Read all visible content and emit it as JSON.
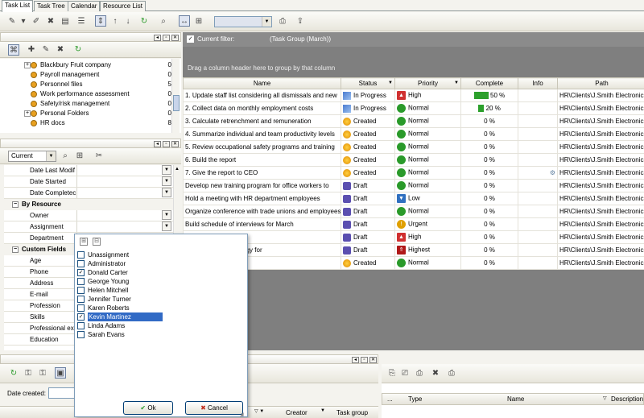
{
  "tabs": [
    "Task List",
    "Task Tree",
    "Calendar",
    "Resource List"
  ],
  "filter": {
    "label": "Current filter:",
    "value": "(Task Group  (March))"
  },
  "group_hint": "Drag a column header here to group by that column",
  "tree_items": [
    {
      "label": "Blackbury Fruit company",
      "count": "0",
      "expander": "+"
    },
    {
      "label": "Payroll management",
      "count": "0",
      "expander": ""
    },
    {
      "label": "Personnel files",
      "count": "5",
      "expander": ""
    },
    {
      "label": "Work performance assessment",
      "count": "0",
      "expander": ""
    },
    {
      "label": "Safety/risk management",
      "count": "0",
      "expander": ""
    },
    {
      "label": "Personal Folders",
      "count": "0",
      "expander": "+"
    },
    {
      "label": "HR docs",
      "count": "8",
      "expander": ""
    }
  ],
  "props_combo": "Current",
  "props": {
    "date_rows": [
      "Date Last Modif",
      "Date Started",
      "Date Completec"
    ],
    "cat_resource": "By Resource",
    "resource_rows": [
      "Owner",
      "Assignment",
      "Department"
    ],
    "cat_custom": "Custom Fields",
    "custom_rows": [
      "Age",
      "Phone",
      "Address",
      "E-mail",
      "Profession",
      "Skills",
      "Professional exp",
      "Education"
    ]
  },
  "columns": {
    "name": "Name",
    "status": "Status",
    "priority": "Priority",
    "complete": "Complete",
    "info": "Info",
    "path": "Path"
  },
  "rows": [
    {
      "name": "1. Update staff list considering all dismissals and new",
      "status": "In Progress",
      "priority": "High",
      "complete": "50 %",
      "path": "HR\\Clients\\J.Smith Electronics,"
    },
    {
      "name": "2. Collect data on monthly employment costs",
      "status": "In Progress",
      "priority": "Normal",
      "complete": "20 %",
      "path": "HR\\Clients\\J.Smith Electronics,"
    },
    {
      "name": "3. Calculate retrenchment and remuneration",
      "status": "Created",
      "priority": "Normal",
      "complete": "0 %",
      "path": "HR\\Clients\\J.Smith Electronics,"
    },
    {
      "name": "4. Summarize individual and team productivity levels",
      "status": "Created",
      "priority": "Normal",
      "complete": "0 %",
      "path": "HR\\Clients\\J.Smith Electronics,"
    },
    {
      "name": "5. Review occupational safety programs and training",
      "status": "Created",
      "priority": "Normal",
      "complete": "0 %",
      "path": "HR\\Clients\\J.Smith Electronics,"
    },
    {
      "name": "6. Build the report",
      "status": "Created",
      "priority": "Normal",
      "complete": "0 %",
      "path": "HR\\Clients\\J.Smith Electronics,"
    },
    {
      "name": "7. Give the report to CEO",
      "status": "Created",
      "priority": "Normal",
      "complete": "0 %",
      "path": "HR\\Clients\\J.Smith Electronics,"
    },
    {
      "name": "Develop new training program for office workers to",
      "status": "Draft",
      "priority": "Normal",
      "complete": "0 %",
      "path": "HR\\Clients\\J.Smith Electronics,"
    },
    {
      "name": "Hold a meeting with HR department employees",
      "status": "Draft",
      "priority": "Low",
      "complete": "0 %",
      "path": "HR\\Clients\\J.Smith Electronics,"
    },
    {
      "name": "Organize conference with trade unions and employees",
      "status": "Draft",
      "priority": "Normal",
      "complete": "0 %",
      "path": "HR\\Clients\\J.Smith Electronics,"
    },
    {
      "name": "Build schedule of interviews for March",
      "status": "Draft",
      "priority": "Urgent",
      "complete": "0 %",
      "path": "HR\\Clients\\J.Smith Electronics,"
    },
    {
      "name": "edit department",
      "status": "Draft",
      "priority": "High",
      "complete": "0 %",
      "path": "HR\\Clients\\J.Smith Electronics,"
    },
    {
      "name": "e management strategy for",
      "status": "Draft",
      "priority": "Highest",
      "complete": "0 %",
      "path": "HR\\Clients\\J.Smith Electronics,"
    },
    {
      "name": "training with staff",
      "status": "Created",
      "priority": "Normal",
      "complete": "0 %",
      "path": "HR\\Clients\\J.Smith Electronics,"
    }
  ],
  "popup": {
    "items": [
      {
        "label": "Unassignment",
        "checked": false,
        "selected": false
      },
      {
        "label": "Administrator",
        "checked": false,
        "selected": false
      },
      {
        "label": "Donald Carter",
        "checked": true,
        "selected": false
      },
      {
        "label": "George Young",
        "checked": false,
        "selected": false
      },
      {
        "label": "Helen Mitchell",
        "checked": false,
        "selected": false
      },
      {
        "label": "Jennifer Turner",
        "checked": false,
        "selected": false
      },
      {
        "label": "Karen Roberts",
        "checked": false,
        "selected": false
      },
      {
        "label": "Kevin Martinez",
        "checked": true,
        "selected": true
      },
      {
        "label": "Linda  Adams",
        "checked": false,
        "selected": false
      },
      {
        "label": "Sarah Evans",
        "checked": false,
        "selected": false
      }
    ],
    "ok": "Ok",
    "cancel": "Cancel"
  },
  "bottom": {
    "date_created": "Date created:",
    "creator": "Creator",
    "task_group": "Task group",
    "col_dots": "...",
    "col_type": "Type",
    "col_name": "Name",
    "col_desc": "Description"
  },
  "colors": {
    "accent": "#316ac5",
    "grid_bg": "#7f7f7f",
    "progress": "#2ca02c"
  }
}
